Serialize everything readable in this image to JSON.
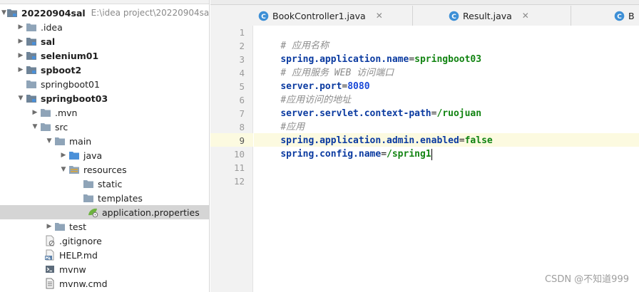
{
  "project_tree": {
    "root": {
      "name": "20220904sal",
      "path": "E:\\idea project\\20220904sal"
    },
    "items": [
      {
        "label": ".idea"
      },
      {
        "label": "sal"
      },
      {
        "label": "selenium01"
      },
      {
        "label": "spboot2"
      },
      {
        "label": "springboot01"
      },
      {
        "label": "springboot03"
      },
      {
        "label": ".mvn"
      },
      {
        "label": "src"
      },
      {
        "label": "main"
      },
      {
        "label": "java"
      },
      {
        "label": "resources"
      },
      {
        "label": "static"
      },
      {
        "label": "templates"
      },
      {
        "label": "application.properties"
      },
      {
        "label": "test"
      },
      {
        "label": ".gitignore"
      },
      {
        "label": "HELP.md"
      },
      {
        "label": "mvnw"
      },
      {
        "label": "mvnw.cmd"
      }
    ]
  },
  "tabs": [
    {
      "label": "BookController1.java"
    },
    {
      "label": "Result.java"
    },
    {
      "label": "B"
    }
  ],
  "editor": {
    "line_numbers": [
      "1",
      "2",
      "3",
      "4",
      "5",
      "6",
      "7",
      "8",
      "9",
      "10",
      "11",
      "12"
    ],
    "current_line": 9,
    "lines": [
      {
        "comment": "# 应用名称"
      },
      {
        "key": "spring.application.name",
        "eq": "=",
        "value": "springboot03"
      },
      {
        "comment": "# 应用服务 WEB 访问端口"
      },
      {
        "key": "server.port",
        "eq": "=",
        "number": "8080"
      },
      {
        "comment": "#应用访问的地址"
      },
      {
        "key": "server.servlet.context-path",
        "eq": "=",
        "value": "/ruojuan"
      },
      {
        "comment": "#应用"
      },
      {
        "key": "spring.application.admin.enabled",
        "eq": "=",
        "value": "false"
      },
      {
        "key": "spring.config.name",
        "eq": "=",
        "value": "/spring1"
      }
    ]
  },
  "watermark": "CSDN @不知道999",
  "colors": {
    "folder": "#8fa4b8",
    "module_folder": "#6f8498",
    "source_folder": "#4a90d9",
    "resources_folder": "#d9a63a",
    "selected_row": "#d5d5d5",
    "current_line": "#fcfae0"
  }
}
